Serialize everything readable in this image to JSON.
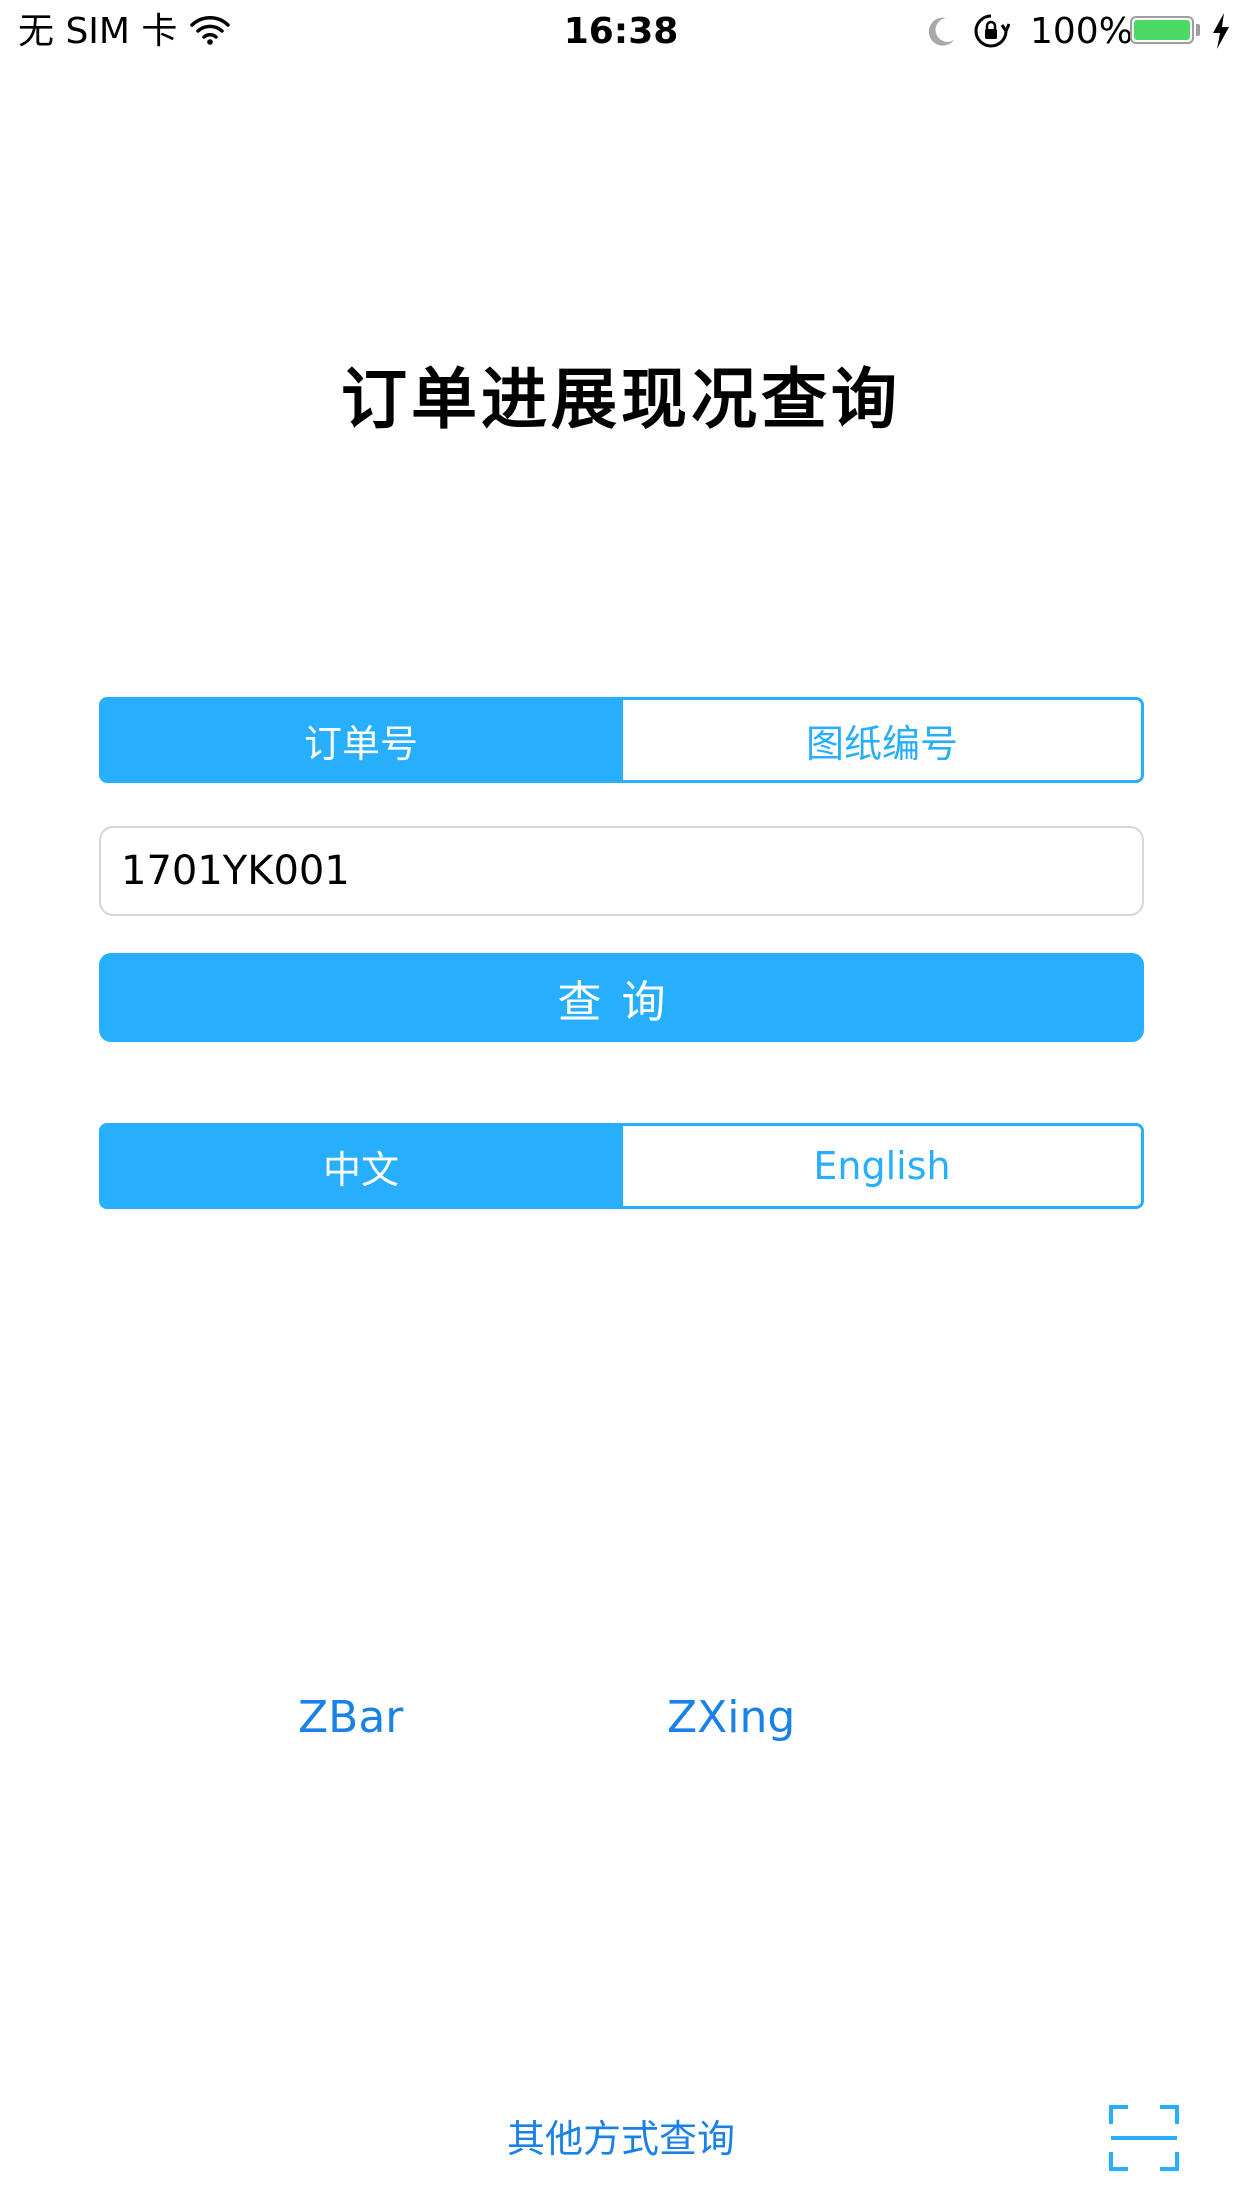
{
  "status_bar": {
    "carrier": "无 SIM 卡",
    "time": "16:38",
    "battery_percent": "100%",
    "icons": [
      "wifi-icon",
      "moon-icon",
      "rotation-lock-icon",
      "battery-icon",
      "charging-icon"
    ]
  },
  "title": "订单进展现况查询",
  "query_type": {
    "options": [
      "订单号",
      "图纸编号"
    ],
    "selected": "订单号"
  },
  "order_input": {
    "value": "1701YK001",
    "placeholder": ""
  },
  "query_button": {
    "label": "查询"
  },
  "language": {
    "options": [
      "中文",
      "English"
    ],
    "selected": "中文"
  },
  "scanners": {
    "zbar": "ZBar",
    "zxing": "ZXing"
  },
  "footer": {
    "other_link": "其他方式查询",
    "scan_icon": "scan-icon"
  },
  "colors": {
    "accent": "#27aefc",
    "link": "#1a82e6",
    "battery": "#4cd964"
  }
}
